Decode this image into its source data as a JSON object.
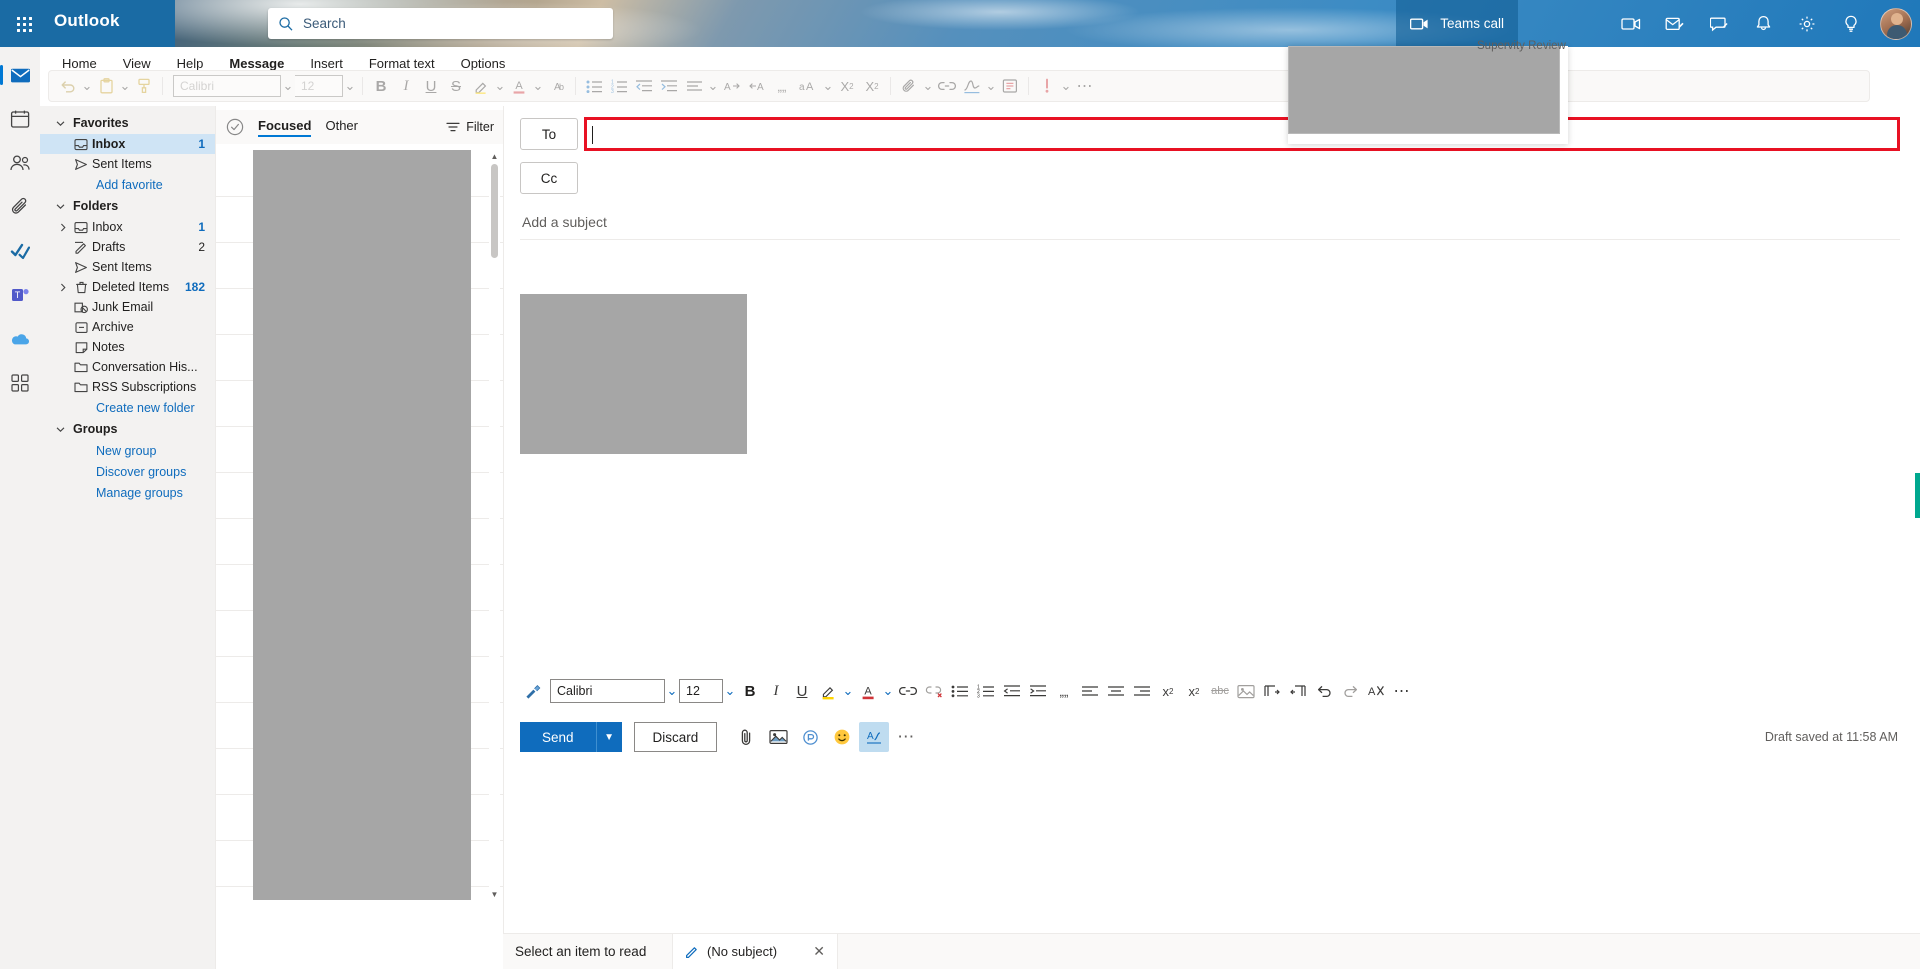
{
  "topbar": {
    "waffle_label": "App launcher",
    "brand": "Outlook",
    "search_placeholder": "Search",
    "search_value": "",
    "teams_call": "Teams call",
    "icons": [
      "teams-call-icon",
      "meet-now-icon",
      "mail-compose-icon",
      "feedback-icon",
      "notifications-icon",
      "settings-icon",
      "tips-icon"
    ]
  },
  "rail": {
    "items": [
      {
        "name": "mail",
        "label": "Mail",
        "active": true
      },
      {
        "name": "calendar",
        "label": "Calendar",
        "active": false
      },
      {
        "name": "people",
        "label": "People",
        "active": false
      },
      {
        "name": "files",
        "label": "Files",
        "active": false
      },
      {
        "name": "to-do",
        "label": "To Do",
        "active": false
      },
      {
        "name": "teams",
        "label": "Teams",
        "active": false
      },
      {
        "name": "onedrive",
        "label": "OneDrive",
        "active": false
      },
      {
        "name": "apps",
        "label": "Apps",
        "active": false
      }
    ]
  },
  "ribbon_tabs": [
    {
      "label": "Home",
      "active": false
    },
    {
      "label": "View",
      "active": false
    },
    {
      "label": "Help",
      "active": false
    },
    {
      "label": "Message",
      "active": true
    },
    {
      "label": "Insert",
      "active": false
    },
    {
      "label": "Format text",
      "active": false
    },
    {
      "label": "Options",
      "active": false
    }
  ],
  "ribbon": {
    "font_name": "Calibri",
    "font_size": "12",
    "buttons": [
      "undo",
      "undo-caret",
      "paste",
      "paste-caret",
      "format-painter",
      "bold",
      "italic",
      "underline",
      "strikethrough",
      "highlight",
      "highlight-caret",
      "font-color",
      "font-color-caret",
      "clear-formatting",
      "bulleted-list",
      "numbered-list",
      "decrease-indent",
      "increase-indent",
      "align",
      "align-caret",
      "ltr",
      "rtl",
      "quote",
      "change-case",
      "change-case-caret",
      "subscript",
      "superscript",
      "attach",
      "attach-caret",
      "link",
      "signature",
      "signature-caret",
      "immersive-reader",
      "importance",
      "importance-caret",
      "more"
    ]
  },
  "folderpane": {
    "groups": [
      {
        "name": "Favorites",
        "label": "Favorites",
        "expanded": true,
        "items": [
          {
            "label": "Inbox",
            "icon": "inbox-icon",
            "count": "1",
            "selected": true,
            "expandable": false
          },
          {
            "label": "Sent Items",
            "icon": "sent-icon",
            "count": "",
            "selected": false,
            "expandable": false
          }
        ],
        "link": "Add favorite"
      },
      {
        "name": "Folders",
        "label": "Folders",
        "expanded": true,
        "items": [
          {
            "label": "Inbox",
            "icon": "inbox-icon",
            "count": "1",
            "selected": false,
            "expandable": true
          },
          {
            "label": "Drafts",
            "icon": "drafts-icon",
            "count": "2",
            "selected": false,
            "expandable": false,
            "plain_count": true
          },
          {
            "label": "Sent Items",
            "icon": "sent-icon",
            "count": "",
            "selected": false,
            "expandable": false
          },
          {
            "label": "Deleted Items",
            "icon": "trash-icon",
            "count": "182",
            "selected": false,
            "expandable": true
          },
          {
            "label": "Junk Email",
            "icon": "junk-icon",
            "count": "",
            "selected": false,
            "expandable": false
          },
          {
            "label": "Archive",
            "icon": "archive-icon",
            "count": "",
            "selected": false,
            "expandable": false
          },
          {
            "label": "Notes",
            "icon": "notes-icon",
            "count": "",
            "selected": false,
            "expandable": false
          },
          {
            "label": "Conversation His...",
            "icon": "folder-icon",
            "count": "",
            "selected": false,
            "expandable": false
          },
          {
            "label": "RSS Subscriptions",
            "icon": "folder-icon",
            "count": "",
            "selected": false,
            "expandable": false
          }
        ],
        "link": "Create new folder"
      },
      {
        "name": "Groups",
        "label": "Groups",
        "expanded": true,
        "items": [],
        "links": [
          "New group",
          "Discover groups",
          "Manage groups"
        ]
      }
    ]
  },
  "msglist": {
    "select_all_icon": "check-circle-icon",
    "tabs": [
      {
        "label": "Focused",
        "active": true
      },
      {
        "label": "Other",
        "active": false
      }
    ],
    "filter_label": "Filter",
    "filter_icon": "filter-icon"
  },
  "compose": {
    "to_label": "To",
    "to_value": "",
    "to_highlight_color": "#e81123",
    "cc_label": "Cc",
    "cc_value": "",
    "subject_placeholder": "Add a subject",
    "subject_value": "",
    "body_value": "",
    "format_toolbar": {
      "font_name": "Calibri",
      "font_size": "12",
      "buttons": [
        "format-painter",
        "bold",
        "italic",
        "underline",
        "highlight",
        "highlight-caret",
        "font-color",
        "font-color-caret",
        "link",
        "remove-link",
        "bulleted-list",
        "numbered-list",
        "decrease-indent",
        "increase-indent",
        "quote",
        "align-left",
        "align-center",
        "align-right",
        "superscript",
        "subscript",
        "strikethrough",
        "insert-image",
        "ltr",
        "rtl",
        "undo",
        "redo",
        "clear-formatting",
        "more-options"
      ]
    },
    "send_label": "Send",
    "send_caret": "send-options-caret",
    "discard_label": "Discard",
    "action_icons": [
      "attach-file-icon",
      "insert-picture-icon",
      "loop-component-icon",
      "emoji-icon",
      "signature-icon",
      "more-actions-icon"
    ],
    "draft_status": "Draft saved at 11:58 AM"
  },
  "bottombar": {
    "reading_hint": "Select an item to read",
    "tab_icon": "pencil-icon",
    "tab_label": "(No subject)",
    "tab_close": "close-icon"
  },
  "overlay": {
    "superdiv_text": "Supervity Review"
  },
  "colors": {
    "accent": "#0f6cbd",
    "brand_blue": "#1a6ba4",
    "highlight_red": "#e81123",
    "selection": "#cfe4f5",
    "placeholder_gray": "#a6a6a6",
    "green_tab": "#00a88f"
  }
}
